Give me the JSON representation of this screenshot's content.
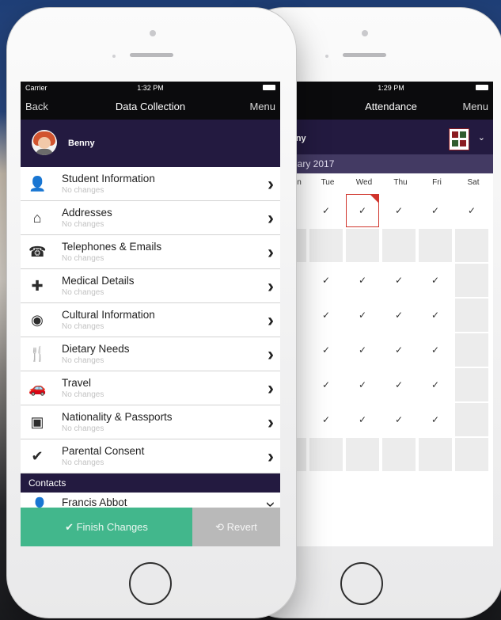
{
  "colors": {
    "nav_bg": "#0b0b0d",
    "profile_bg": "#231a40",
    "finish_green": "#42b78c",
    "revert_gray": "#b9b9b9",
    "highlight_red": "#d0342c"
  },
  "front": {
    "status": {
      "carrier": "Carrier",
      "time": "1:32 PM"
    },
    "nav": {
      "back": "Back",
      "title": "Data Collection",
      "menu": "Menu"
    },
    "profile": {
      "name": "Benny"
    },
    "items": [
      {
        "title": "Student Information",
        "sub": "No changes",
        "icon": "person-icon",
        "glyph": "👤"
      },
      {
        "title": "Addresses",
        "sub": "No changes",
        "icon": "home-icon",
        "glyph": "⌂"
      },
      {
        "title": "Telephones & Emails",
        "sub": "No changes",
        "icon": "phone-icon",
        "glyph": "☎"
      },
      {
        "title": "Medical Details",
        "sub": "No changes",
        "icon": "medical-kit-icon",
        "glyph": "✚"
      },
      {
        "title": "Cultural Information",
        "sub": "No changes",
        "icon": "globe-icon",
        "glyph": "◉"
      },
      {
        "title": "Dietary Needs",
        "sub": "No changes",
        "icon": "cutlery-icon",
        "glyph": "🍴"
      },
      {
        "title": "Travel",
        "sub": "No changes",
        "icon": "car-icon",
        "glyph": "🚗"
      },
      {
        "title": "Nationality & Passports",
        "sub": "No changes",
        "icon": "passport-icon",
        "glyph": "▣"
      },
      {
        "title": "Parental Consent",
        "sub": "No changes",
        "icon": "checkmark-icon",
        "glyph": "✔"
      }
    ],
    "contacts_header": "Contacts",
    "contact": {
      "name": "Francis Abbot"
    },
    "buttons": {
      "finish": "✔ Finish Changes",
      "revert": "⟲ Revert"
    }
  },
  "back": {
    "status": {
      "time": "1:29 PM"
    },
    "nav": {
      "title": "Attendance",
      "menu": "Menu"
    },
    "profile": {
      "name_partial": "nny"
    },
    "month": "uary 2017",
    "days": [
      "n",
      "Tue",
      "Wed",
      "Thu",
      "Fri",
      "Sat"
    ],
    "check": "✓"
  }
}
